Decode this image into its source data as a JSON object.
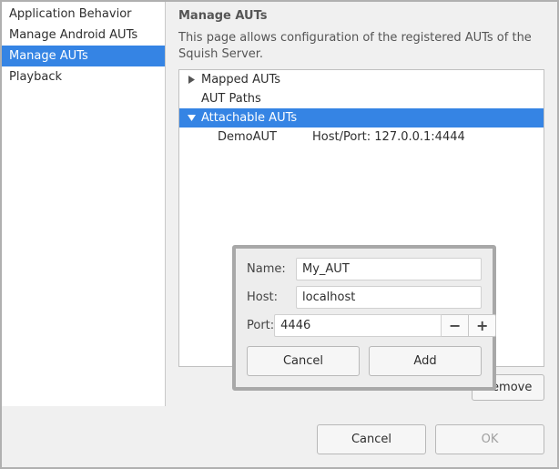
{
  "sidebar": {
    "items": [
      {
        "label": "Application Behavior"
      },
      {
        "label": "Manage Android AUTs"
      },
      {
        "label": "Manage AUTs"
      },
      {
        "label": "Playback"
      }
    ],
    "selected_index": 2
  },
  "page": {
    "title": "Manage AUTs",
    "description": "This page allows configuration of the registered AUTs of the Squish Server."
  },
  "tree": {
    "nodes": [
      {
        "label": "Mapped AUTs",
        "expanded": false
      },
      {
        "label": "AUT Paths",
        "expanded": null
      },
      {
        "label": "Attachable AUTs",
        "expanded": true,
        "selected": true
      }
    ],
    "attachable_entries": [
      {
        "name": "DemoAUT",
        "hostport_label": "Host/Port:",
        "hostport_value": "127.0.0.1:4444"
      }
    ]
  },
  "buttons": {
    "add": "Add",
    "remove": "Remove",
    "cancel": "Cancel",
    "ok": "OK"
  },
  "popup": {
    "labels": {
      "name": "Name:",
      "host": "Host:",
      "port": "Port:"
    },
    "values": {
      "name": "My_AUT",
      "host": "localhost",
      "port": "4446"
    },
    "buttons": {
      "cancel": "Cancel",
      "add": "Add"
    }
  }
}
